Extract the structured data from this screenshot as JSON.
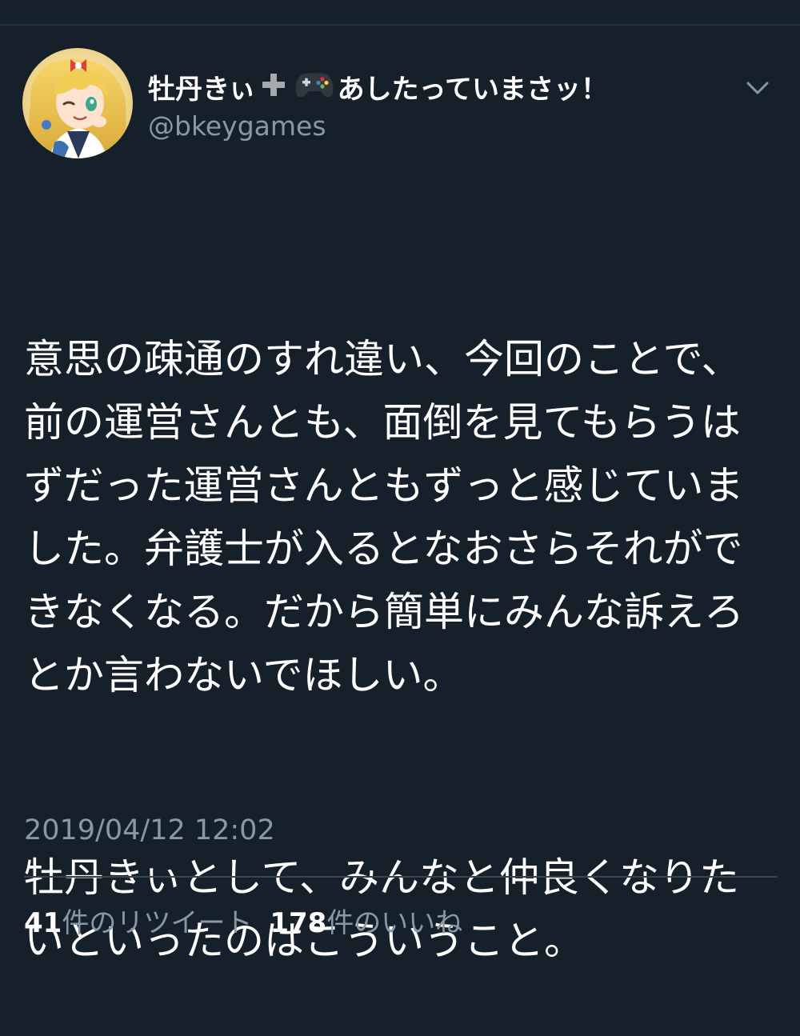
{
  "tweet": {
    "author": {
      "display_name": "牡丹きぃ",
      "display_name_suffix": "あしたっていまさッ！",
      "emoji": [
        "heavy-plus-icon",
        "game-controller-icon"
      ],
      "handle": "@bkeygames",
      "avatar": "anime-girl-avatar"
    },
    "menu_icon": "chevron-down-icon",
    "paragraphs": [
      "意思の疎通のすれ違い、今回のことで、前の運営さんとも、面倒を見てもらうはずだった運営さんともずっと感じていました。弁護士が入るとなおさらそれができなくなる。だから簡単にみんな訴えろとか言わないでほしい。",
      "牡丹きぃとして、みんなと仲良くなりたいといったのはこういうこと。"
    ],
    "timestamp": "2019/04/12 12:02",
    "stats": {
      "retweets_count": "41",
      "retweets_label": "件のリツイート",
      "likes_count": "178",
      "likes_label": "件のいいね"
    }
  },
  "colors": {
    "background": "#15202b",
    "text_primary": "#ffffff",
    "text_secondary": "#8899a6",
    "divider": "#38444d"
  }
}
